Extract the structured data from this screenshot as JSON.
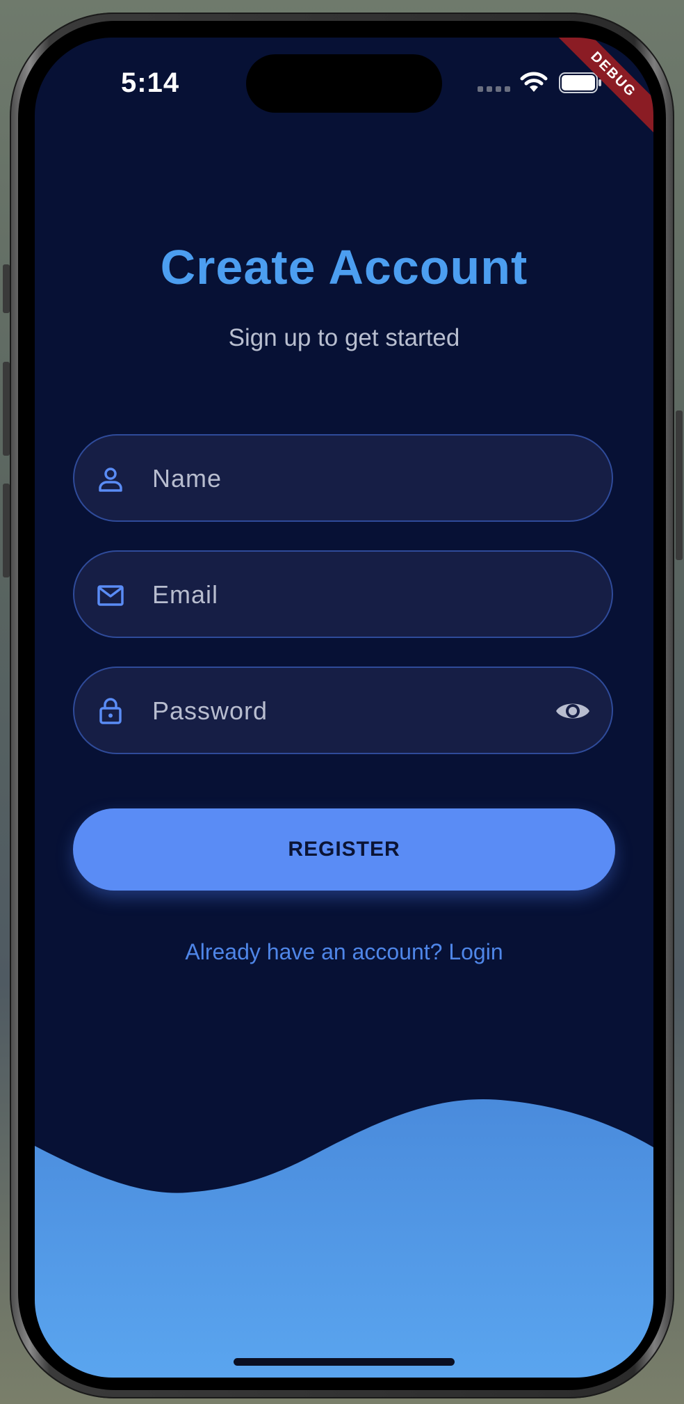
{
  "status_bar": {
    "time": "5:14",
    "icons": [
      "signal-icon",
      "wifi-icon",
      "battery-icon"
    ]
  },
  "debug_banner": "DEBUG",
  "header": {
    "title": "Create Account",
    "subtitle": "Sign up to get started"
  },
  "form": {
    "name": {
      "placeholder": "Name",
      "value": "",
      "icon": "person-icon"
    },
    "email": {
      "placeholder": "Email",
      "value": "",
      "icon": "mail-icon"
    },
    "password": {
      "placeholder": "Password",
      "value": "",
      "icon": "lock-icon",
      "toggle_icon": "eye-icon"
    }
  },
  "actions": {
    "register_label": "REGISTER",
    "login_link": "Already have an account? Login"
  },
  "colors": {
    "background": "#071135",
    "accent": "#4c9ef0",
    "button": "#5a8cf5",
    "field_bg": "#161e45",
    "field_border": "#2f4b9a",
    "wave": "#4f8fe0"
  }
}
